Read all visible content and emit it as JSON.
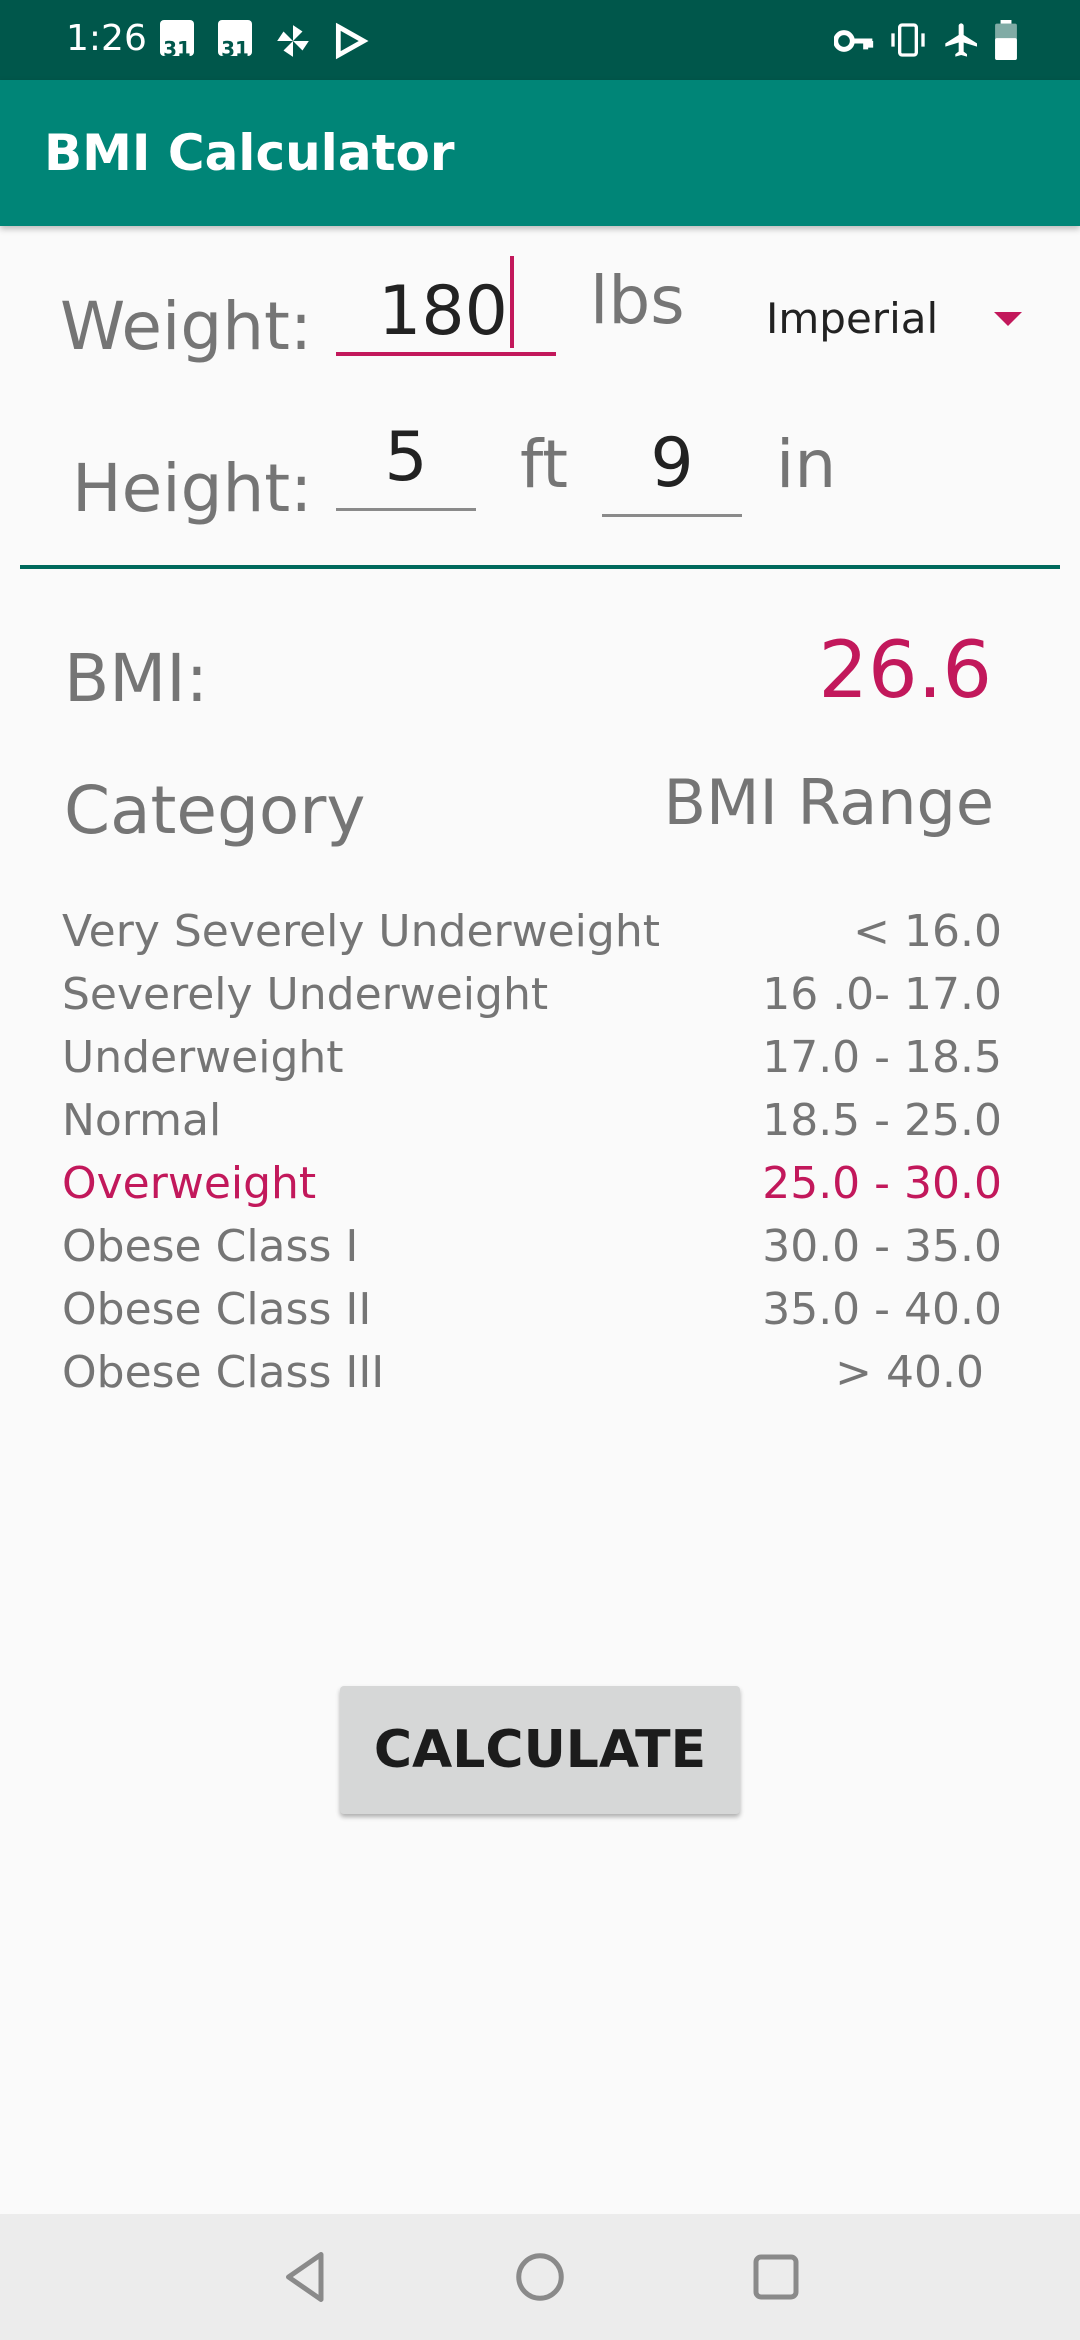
{
  "status_bar": {
    "time": "1:26",
    "calendar_day_1": "31",
    "calendar_day_2": "31"
  },
  "app_bar": {
    "title": "BMI Calculator"
  },
  "form": {
    "weight_label": "Weight:",
    "weight_value": "180",
    "weight_unit": "lbs",
    "unit_system": "Imperial",
    "height_label": "Height:",
    "height_feet_value": "5",
    "feet_unit": "ft",
    "height_inches_value": "9",
    "inches_unit": "in"
  },
  "result": {
    "bmi_label": "BMI:",
    "bmi_value": "26.6",
    "category_header": "Category",
    "range_header": "BMI Range"
  },
  "categories": [
    {
      "name": "Very Severely Underweight",
      "range": "< 16.0",
      "highlighted": false
    },
    {
      "name": "Severely Underweight",
      "range": "16 .0- 17.0",
      "highlighted": false
    },
    {
      "name": "Underweight",
      "range": "17.0 - 18.5",
      "highlighted": false
    },
    {
      "name": "Normal",
      "range": "18.5 - 25.0",
      "highlighted": false
    },
    {
      "name": "Overweight",
      "range": "25.0 - 30.0",
      "highlighted": true
    },
    {
      "name": "Obese Class I",
      "range": "30.0 - 35.0",
      "highlighted": false
    },
    {
      "name": "Obese Class II",
      "range": "35.0 - 40.0",
      "highlighted": false
    },
    {
      "name": "Obese Class III",
      "range": "> 40.0",
      "highlighted": false
    }
  ],
  "actions": {
    "calculate_label": "CALCULATE"
  },
  "colors": {
    "primary": "#008577",
    "primary_dark": "#00574b",
    "accent": "#c2185b"
  }
}
